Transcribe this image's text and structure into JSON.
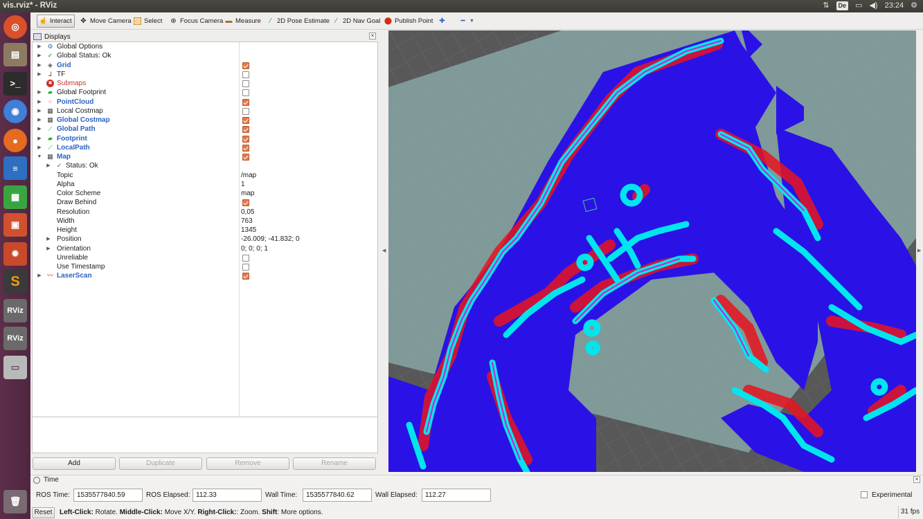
{
  "window": {
    "title": "vis.rviz* - RViz"
  },
  "system_tray": {
    "keyboard_layout": "De",
    "clock": "23:24"
  },
  "launcher": {
    "items": [
      "ubuntu-logo-icon",
      "files-icon",
      "terminal-icon",
      "chromium-icon",
      "firefox-icon",
      "writer-icon",
      "calc-icon",
      "impress-icon",
      "settings-icon",
      "sublime-icon",
      "rviz-icon",
      "rviz-icon",
      "drive-icon",
      "trash-icon"
    ],
    "rviz_label": "RViz"
  },
  "toolbar": {
    "interact": "Interact",
    "move_camera": "Move Camera",
    "select": "Select",
    "focus_camera": "Focus Camera",
    "measure": "Measure",
    "pose_estimate": "2D Pose Estimate",
    "nav_goal": "2D Nav Goal",
    "publish_point": "Publish Point"
  },
  "displays_panel": {
    "title": "Displays",
    "rows": [
      {
        "label": "Global Options",
        "style": "normal",
        "arrow": "collapsed",
        "indent": 0,
        "icon": "gear-icon",
        "check": null,
        "value": ""
      },
      {
        "label": "Global Status: Ok",
        "style": "normal",
        "arrow": "collapsed",
        "indent": 0,
        "icon": "checkmark-icon",
        "check": null,
        "value": ""
      },
      {
        "label": "Grid",
        "style": "blue",
        "arrow": "collapsed",
        "indent": 0,
        "icon": "grid-icon",
        "check": true,
        "value": ""
      },
      {
        "label": "TF",
        "style": "normal",
        "arrow": "collapsed",
        "indent": 0,
        "icon": "tf-axes-icon",
        "check": false,
        "value": ""
      },
      {
        "label": "Submaps",
        "style": "red",
        "arrow": "none",
        "indent": 0,
        "icon": "error-icon",
        "check": false,
        "value": ""
      },
      {
        "label": "Global Footprint",
        "style": "normal",
        "arrow": "collapsed",
        "indent": 0,
        "icon": "polygon-icon",
        "check": false,
        "value": ""
      },
      {
        "label": "PointCloud",
        "style": "blue",
        "arrow": "collapsed",
        "indent": 0,
        "icon": "pointcloud-icon",
        "check": true,
        "value": ""
      },
      {
        "label": "Local Costmap",
        "style": "normal",
        "arrow": "collapsed",
        "indent": 0,
        "icon": "map-grid-icon",
        "check": false,
        "value": ""
      },
      {
        "label": "Global Costmap",
        "style": "blue",
        "arrow": "collapsed",
        "indent": 0,
        "icon": "map-grid-icon",
        "check": true,
        "value": ""
      },
      {
        "label": "Global Path",
        "style": "blue",
        "arrow": "collapsed",
        "indent": 0,
        "icon": "path-icon",
        "check": true,
        "value": ""
      },
      {
        "label": "Footprint",
        "style": "blue",
        "arrow": "collapsed",
        "indent": 0,
        "icon": "polygon-icon",
        "check": true,
        "value": ""
      },
      {
        "label": "LocalPath",
        "style": "blue",
        "arrow": "collapsed",
        "indent": 0,
        "icon": "path-icon",
        "check": true,
        "value": ""
      },
      {
        "label": "Map",
        "style": "blue",
        "arrow": "expanded",
        "indent": 0,
        "icon": "map-grid-icon",
        "check": true,
        "value": ""
      },
      {
        "label": "Status: Ok",
        "style": "normal",
        "arrow": "collapsed",
        "indent": 1,
        "icon": "checkmark-icon",
        "check": null,
        "value": ""
      },
      {
        "label": "Topic",
        "style": "normal",
        "arrow": "none",
        "indent": 1,
        "icon": "",
        "check": null,
        "value": "/map"
      },
      {
        "label": "Alpha",
        "style": "normal",
        "arrow": "none",
        "indent": 1,
        "icon": "",
        "check": null,
        "value": "1"
      },
      {
        "label": "Color Scheme",
        "style": "normal",
        "arrow": "none",
        "indent": 1,
        "icon": "",
        "check": null,
        "value": "map"
      },
      {
        "label": "Draw Behind",
        "style": "normal",
        "arrow": "none",
        "indent": 1,
        "icon": "",
        "check": true,
        "value": ""
      },
      {
        "label": "Resolution",
        "style": "normal",
        "arrow": "none",
        "indent": 1,
        "icon": "",
        "check": null,
        "value": "0,05"
      },
      {
        "label": "Width",
        "style": "normal",
        "arrow": "none",
        "indent": 1,
        "icon": "",
        "check": null,
        "value": "763"
      },
      {
        "label": "Height",
        "style": "normal",
        "arrow": "none",
        "indent": 1,
        "icon": "",
        "check": null,
        "value": "1345"
      },
      {
        "label": "Position",
        "style": "normal",
        "arrow": "collapsed",
        "indent": 1,
        "icon": "",
        "check": null,
        "value": "-26.009; -41.832; 0"
      },
      {
        "label": "Orientation",
        "style": "normal",
        "arrow": "collapsed",
        "indent": 1,
        "icon": "",
        "check": null,
        "value": "0; 0; 0; 1"
      },
      {
        "label": "Unreliable",
        "style": "normal",
        "arrow": "none",
        "indent": 1,
        "icon": "",
        "check": false,
        "value": ""
      },
      {
        "label": "Use Timestamp",
        "style": "normal",
        "arrow": "none",
        "indent": 1,
        "icon": "",
        "check": false,
        "value": ""
      },
      {
        "label": "LaserScan",
        "style": "blue",
        "arrow": "collapsed",
        "indent": 0,
        "icon": "laserscan-icon",
        "check": true,
        "value": ""
      }
    ],
    "buttons": {
      "add": "Add",
      "duplicate": "Duplicate",
      "remove": "Remove",
      "rename": "Rename"
    }
  },
  "time_panel": {
    "title": "Time",
    "ros_time_label": "ROS Time:",
    "ros_time": "1535577840.59",
    "ros_elapsed_label": "ROS Elapsed:",
    "ros_elapsed": "112.33",
    "wall_time_label": "Wall Time:",
    "wall_time": "1535577840.62",
    "wall_elapsed_label": "Wall Elapsed:",
    "wall_elapsed": "112.27",
    "experimental_label": "Experimental"
  },
  "status_bar": {
    "reset": "Reset",
    "hint_left_key": "Left-Click:",
    "hint_left": " Rotate. ",
    "hint_middle_key": "Middle-Click:",
    "hint_middle": " Move X/Y. ",
    "hint_right_key": "Right-Click:",
    "hint_right": ": Zoom. ",
    "hint_shift_key": "Shift",
    "hint_shift": ": More options.",
    "fps": "31 fps"
  },
  "viewport": {
    "colors": {
      "background": "#585858",
      "map_floor": "#7f9a99",
      "free_space": "#2a12e6",
      "inflation": "#e8141e",
      "obstacle": "#00e6ef",
      "wall": "#cc22cc"
    }
  }
}
